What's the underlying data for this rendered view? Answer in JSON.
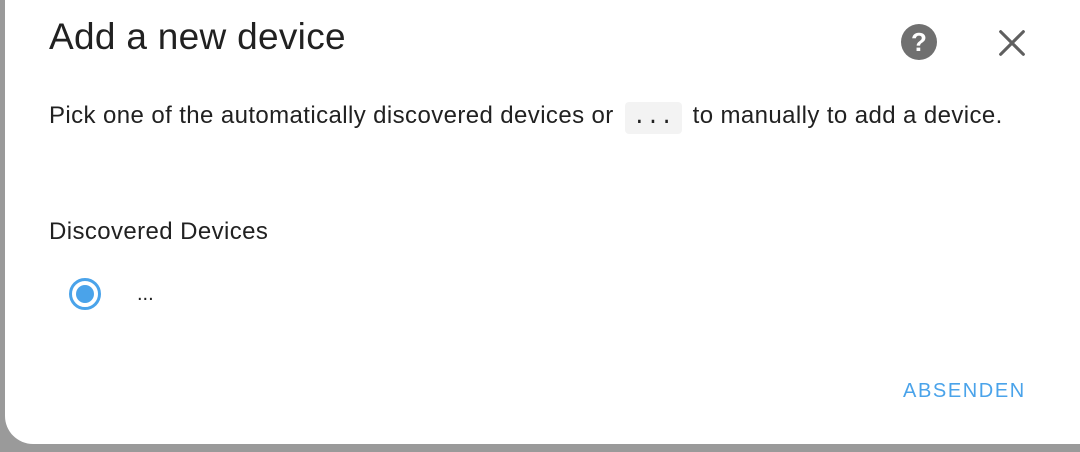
{
  "dialog": {
    "title": "Add a new device",
    "description": {
      "before": "Pick one of the automatically discovered devices or",
      "code": "...",
      "after": "to manually to add a device."
    },
    "discovered_label": "Discovered Devices",
    "options": [
      {
        "label": "...",
        "selected": true
      }
    ],
    "submit_label": "ABSENDEN"
  },
  "icons": {
    "help": "help-circle-icon",
    "close": "close-icon",
    "help_glyph": "?"
  },
  "colors": {
    "accent": "#4aa3ea",
    "text": "#212121",
    "icon": "#707070",
    "backdrop": "#9a9a9a"
  }
}
